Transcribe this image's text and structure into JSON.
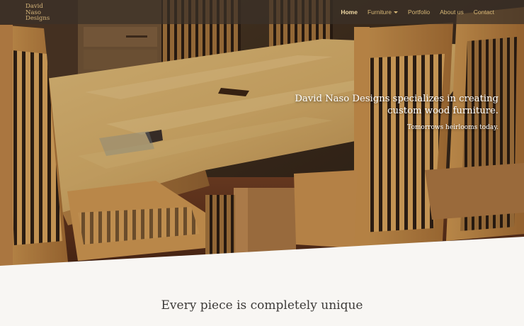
{
  "brand": {
    "line1": "David",
    "line2": "Naso",
    "line3": "Designs"
  },
  "nav": {
    "items": [
      {
        "label": "Home",
        "active": true
      },
      {
        "label": "Furniture",
        "dropdown": true
      },
      {
        "label": "Portfolio"
      },
      {
        "label": "About us"
      },
      {
        "label": "Contact"
      }
    ]
  },
  "hero": {
    "headline_line1": "David Naso Designs specializes in creating",
    "headline_line2": "custom wood furniture.",
    "tagline": "Tomorrows heirlooms today.",
    "image_subject": "maple dining table with slatted-back chairs"
  },
  "section": {
    "heading": "Every piece is completely unique"
  },
  "colors": {
    "navbar_bg": "#3a3028",
    "nav_link": "#d8b877",
    "nav_active": "#f1d9a4",
    "page_bg": "#f8f6f3",
    "heading_text": "#3c3a38"
  },
  "icons": {
    "dropdown": "caret-down-icon"
  }
}
